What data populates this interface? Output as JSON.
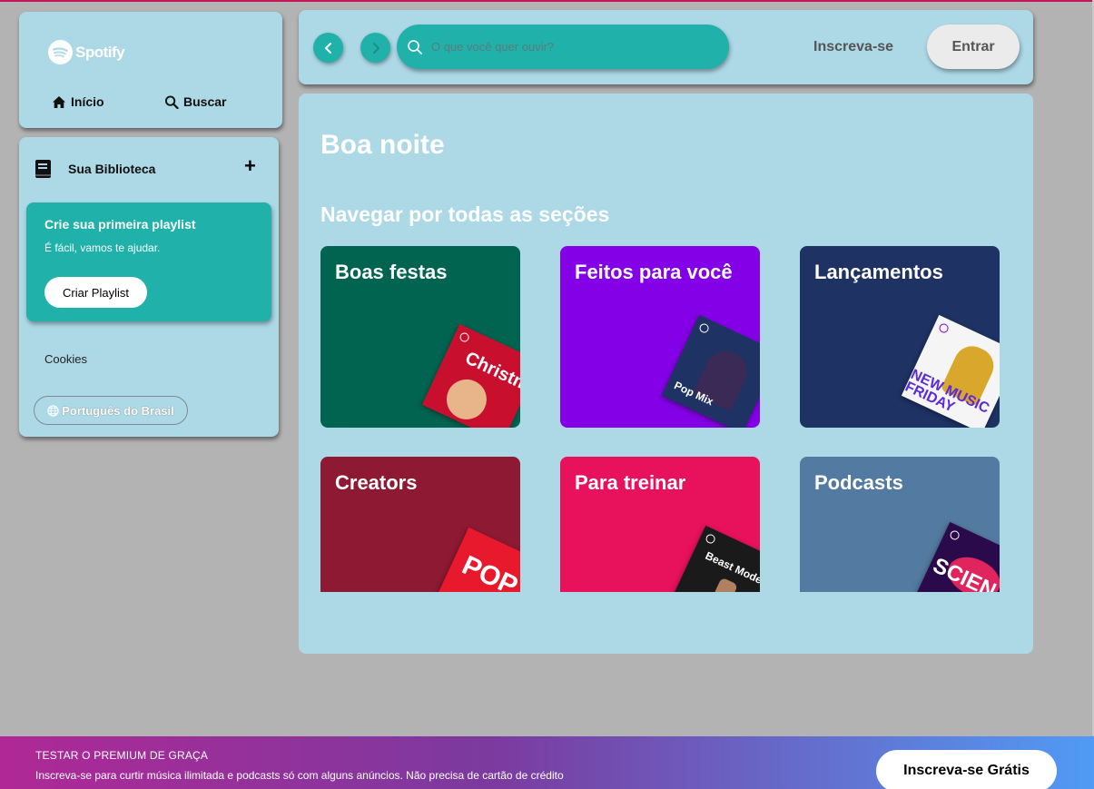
{
  "brand": {
    "name": "Spotify"
  },
  "nav": {
    "home_label": "Início",
    "search_label": "Buscar"
  },
  "library": {
    "title": "Sua Biblioteca",
    "add_label": "+",
    "create_card": {
      "title": "Crie sua primeira playlist",
      "subtitle": "É fácil, vamos te ajudar.",
      "button_label": "Criar Playlist"
    },
    "cookies_label": "Cookies",
    "language_label": "Português do Brasil"
  },
  "topbar": {
    "search_placeholder": "O que você quer ouvir?",
    "signup_label": "Inscreva-se",
    "login_label": "Entrar"
  },
  "main": {
    "greeting": "Boa noite",
    "section_title": "Navegar por todas as seções",
    "cards": [
      {
        "title": "Boas festas",
        "color": "#006450",
        "art_color": "#c8102e",
        "art_text": "Christm Hit"
      },
      {
        "title": "Feitos para você",
        "color": "#8400e7",
        "art_color": "#1e3264",
        "art_text": "Pop Mix"
      },
      {
        "title": "Lançamentos",
        "color": "#1e3264",
        "art_color": "#f5f5f5",
        "art_text": "NEW MUSIC FRIDAY"
      },
      {
        "title": "Creators",
        "color": "#8d1932",
        "art_color": "#e8192c",
        "art_text": "POP"
      },
      {
        "title": "Para treinar",
        "color": "#e8115b",
        "art_color": "#1a1a1a",
        "art_text": "Beast Mode"
      },
      {
        "title": "Podcasts",
        "color": "#537aa1",
        "art_color": "#2a0a4a",
        "art_text": "SCIEN"
      }
    ]
  },
  "premium": {
    "title": "TESTAR O PREMIUM DE GRAÇA",
    "subtitle": "Inscreva-se para curtir música ilimitada e podcasts só com alguns anúncios. Não precisa de cartão de crédito",
    "button_label": "Inscreva-se Grátis"
  }
}
